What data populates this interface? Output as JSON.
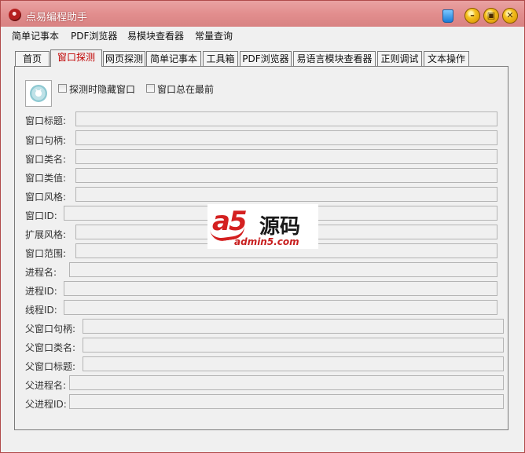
{
  "window": {
    "title": "点易编程助手",
    "app_icon": "app-logo-icon",
    "controls": [
      "minimize-icon",
      "maximize-icon",
      "close-icon"
    ],
    "accent_color": "#e28e8e"
  },
  "menu": {
    "items": [
      "简单记事本",
      "PDF浏览器",
      "易模块查看器",
      "常量查询"
    ]
  },
  "tabs": {
    "items": [
      "首页",
      "窗口探测",
      "网页探测",
      "简单记事本",
      "工具箱",
      "PDF浏览器",
      "易语言模块查看器",
      "正则调试",
      "文本操作"
    ],
    "active_index": 1
  },
  "probe": {
    "icon": "crosshair-probe-icon",
    "hide_when_probing": "探测时隐藏窗口",
    "always_on_top": "窗口总在最前"
  },
  "fields": [
    {
      "label": "窗口标题:",
      "value": ""
    },
    {
      "label": "窗口句柄:",
      "value": ""
    },
    {
      "label": "窗口类名:",
      "value": ""
    },
    {
      "label": "窗口类值:",
      "value": ""
    },
    {
      "label": "窗口风格:",
      "value": ""
    },
    {
      "label": "窗口ID:",
      "value": ""
    },
    {
      "label": "扩展风格:",
      "value": ""
    },
    {
      "label": "窗口范围:",
      "value": ""
    },
    {
      "label": "进程名:",
      "value": ""
    },
    {
      "label": "进程ID:",
      "value": ""
    },
    {
      "label": "线程ID:",
      "value": ""
    },
    {
      "label": "父窗口句柄:",
      "value": ""
    },
    {
      "label": "父窗口类名:",
      "value": ""
    },
    {
      "label": "父窗口标题:",
      "value": ""
    },
    {
      "label": "父进程名:",
      "value": ""
    },
    {
      "label": "父进程ID:",
      "value": ""
    }
  ],
  "watermark": {
    "brand": "a5",
    "brand_cn": "源码",
    "url": "admin5.com"
  }
}
